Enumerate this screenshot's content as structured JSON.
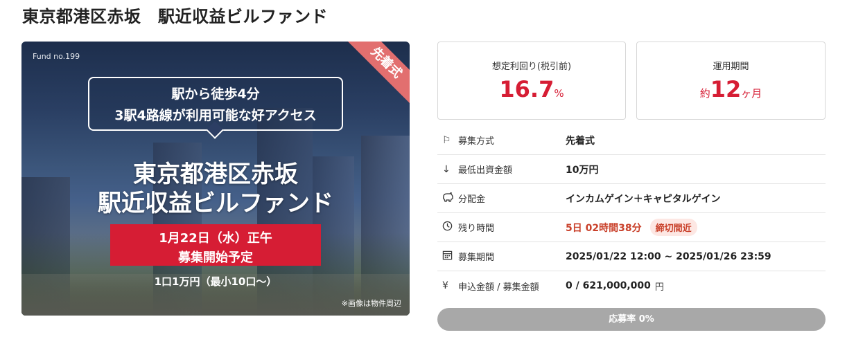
{
  "page": {
    "title": "東京都港区赤坂　駅近収益ビルファンド"
  },
  "hero": {
    "fund_no": "Fund no.199",
    "ribbon": "先着式",
    "bubble_line1": "駅から徒歩4分",
    "bubble_line2": "3駅4路線が利用可能な好アクセス",
    "title_line1": "東京都港区赤坂",
    "title_line2": "駅近収益ビルファンド",
    "date_line": "1月22日（水）正午",
    "start_line": "募集開始予定",
    "unit_note": "1口1万円（最小10口〜）",
    "photo_note": "※画像は物件周辺"
  },
  "stats": {
    "yield_label": "想定利回り(税引前)",
    "yield_value": "16.7",
    "yield_unit": "%",
    "period_label": "運用期間",
    "period_prefix": "約",
    "period_value": "12",
    "period_unit": "ヶ月"
  },
  "details": [
    {
      "icon": "flag-icon",
      "label": "募集方式",
      "value": "先着式"
    },
    {
      "icon": "arrow-down-icon",
      "label": "最低出資金額",
      "value": "10万円"
    },
    {
      "icon": "piggy-bank-icon",
      "label": "分配金",
      "value": "インカムゲイン＋キャピタルゲイン"
    },
    {
      "icon": "clock-icon",
      "label": "残り時間",
      "value": "5日 02時間38分",
      "badge": "締切間近"
    },
    {
      "icon": "calendar-icon",
      "label": "募集期間",
      "value": "2025/01/22 12:00 ~ 2025/01/26 23:59"
    },
    {
      "icon": "yen-icon",
      "label": "申込金額 / 募集金額",
      "value": "0 / 621,000,000",
      "unit": "円"
    }
  ],
  "progress": {
    "label": "応募率 0%",
    "percent": 0
  },
  "colors": {
    "accent_red": "#d61d34",
    "ribbon": "#e26f6f",
    "urgent_text": "#c9402a",
    "progress_bg": "#a8a8a8"
  }
}
